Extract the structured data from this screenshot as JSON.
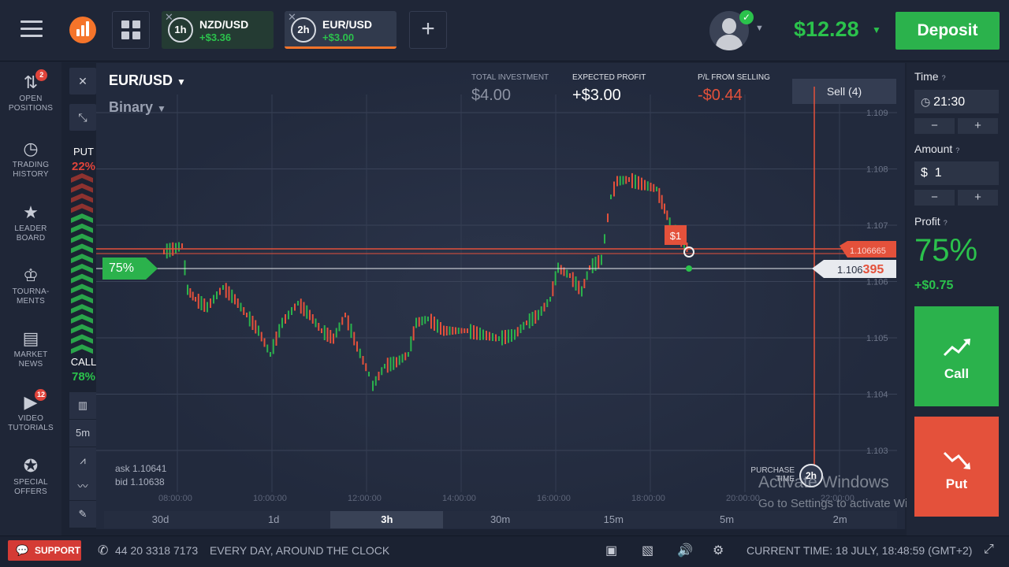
{
  "header": {
    "tabs": [
      {
        "timer": "1h",
        "pair": "NZD/USD",
        "profit": "+$3.36"
      },
      {
        "timer": "2h",
        "pair": "EUR/USD",
        "profit": "+$3.00"
      }
    ],
    "add_tab": "+",
    "balance": "$12.28",
    "deposit_label": "Deposit",
    "colors": {
      "accent_orange": "#f5742a",
      "green": "#2bc24c",
      "red": "#e0443b",
      "bg": "#1f2637"
    }
  },
  "sidebar": {
    "items": [
      {
        "label1": "OPEN",
        "label2": "POSITIONS",
        "icon": "arrows-updown-icon",
        "badge": "2"
      },
      {
        "label1": "TRADING",
        "label2": "HISTORY",
        "icon": "history-icon",
        "badge": ""
      },
      {
        "label1": "LEADER",
        "label2": "BOARD",
        "icon": "leaderboard-icon",
        "badge": ""
      },
      {
        "label1": "TOURNA-",
        "label2": "MENTS",
        "icon": "trophy-icon",
        "badge": ""
      },
      {
        "label1": "MARKET",
        "label2": "NEWS",
        "icon": "news-icon",
        "badge": ""
      },
      {
        "label1": "VIDEO",
        "label2": "TUTORIALS",
        "icon": "play-icon",
        "badge": "12"
      },
      {
        "label1": "SPECIAL",
        "label2": "OFFERS",
        "icon": "offers-icon",
        "badge": ""
      }
    ]
  },
  "chart_panel": {
    "pair": "EUR/USD",
    "option_type": "Binary",
    "sentiment": {
      "put_label": "PUT",
      "put_pct": "22%",
      "call_label": "CALL",
      "call_pct": "78%"
    },
    "chart_tools": {
      "interval": "5m"
    },
    "stats": {
      "total_investment_label": "TOTAL INVESTMENT",
      "total_investment": "$4.00",
      "expected_profit_label": "EXPECTED PROFIT",
      "expected_profit": "+$3.00",
      "pl_label": "P/L FROM SELLING",
      "pl": "-$0.44"
    },
    "sell_label": "Sell (4)",
    "ask": "ask 1.10641",
    "bid": "bid 1.10638",
    "deal_marker": "$1",
    "payout_tag": "75%",
    "current_price_main": "1.106",
    "current_price_tail": "395",
    "deal_price": "1.106665",
    "purchase_line1": "PURCHASE",
    "purchase_line2": "TIME",
    "purchase_timer": "2h",
    "price_ticks": [
      "1.109",
      "1.108",
      "1.107",
      "1.106",
      "1.105",
      "1.104",
      "1.103"
    ],
    "time_ticks": [
      "08:00:00",
      "10:00:00",
      "12:00:00",
      "14:00:00",
      "16:00:00",
      "18:00:00",
      "20:00:00",
      "22:00:00"
    ],
    "timeframes": [
      "30d",
      "1d",
      "3h",
      "30m",
      "15m",
      "5m",
      "2m"
    ],
    "active_timeframe": "3h"
  },
  "right_panel": {
    "time_label": "Time",
    "time_value": "21:30",
    "amount_label": "Amount",
    "amount_currency": "$",
    "amount_value": "1",
    "minus": "−",
    "plus": "+",
    "profit_label": "Profit",
    "profit_pct": "75%",
    "profit_amount": "+$0.75",
    "call_label": "Call",
    "put_label": "Put"
  },
  "watermark": {
    "line1": "Activate Windows",
    "line2": "Go to Settings to activate Windows."
  },
  "footer": {
    "support_label": "SUPPORT",
    "phone": "44 20 3318 7173",
    "availability": "EVERY DAY, AROUND THE CLOCK",
    "current_time": "CURRENT TIME: 18 JULY, 18:48:59 (GMT+2)"
  }
}
